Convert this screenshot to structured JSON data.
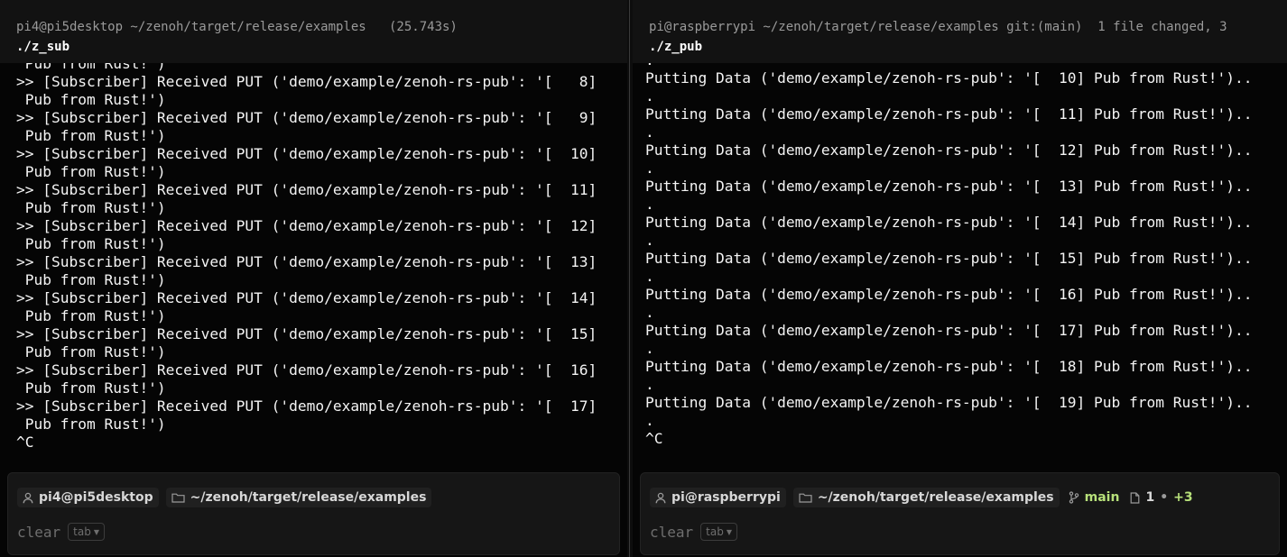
{
  "left": {
    "header": {
      "prompt": "pi4@pi5desktop ~/zenoh/target/release/examples   (25.743s)",
      "command": "./z_sub"
    },
    "output": [
      " Pub from Rust!')",
      ">> [Subscriber] Received PUT ('demo/example/zenoh-rs-pub': '[   8]",
      " Pub from Rust!')",
      ">> [Subscriber] Received PUT ('demo/example/zenoh-rs-pub': '[   9]",
      " Pub from Rust!')",
      ">> [Subscriber] Received PUT ('demo/example/zenoh-rs-pub': '[  10]",
      " Pub from Rust!')",
      ">> [Subscriber] Received PUT ('demo/example/zenoh-rs-pub': '[  11]",
      " Pub from Rust!')",
      ">> [Subscriber] Received PUT ('demo/example/zenoh-rs-pub': '[  12]",
      " Pub from Rust!')",
      ">> [Subscriber] Received PUT ('demo/example/zenoh-rs-pub': '[  13]",
      " Pub from Rust!')",
      ">> [Subscriber] Received PUT ('demo/example/zenoh-rs-pub': '[  14]",
      " Pub from Rust!')",
      ">> [Subscriber] Received PUT ('demo/example/zenoh-rs-pub': '[  15]",
      " Pub from Rust!')",
      ">> [Subscriber] Received PUT ('demo/example/zenoh-rs-pub': '[  16]",
      " Pub from Rust!')",
      ">> [Subscriber] Received PUT ('demo/example/zenoh-rs-pub': '[  17]",
      " Pub from Rust!')",
      "^C"
    ],
    "input": {
      "user": "pi4@pi5desktop",
      "path": "~/zenoh/target/release/examples",
      "command": "clear",
      "tab_hint": "tab"
    }
  },
  "right": {
    "header": {
      "prompt": "pi@raspberrypi ~/zenoh/target/release/examples git:(main)  1 file changed, 3",
      "command": "./z_pub"
    },
    "output": [
      ".",
      "Putting Data ('demo/example/zenoh-rs-pub': '[  10] Pub from Rust!')..",
      ".",
      "Putting Data ('demo/example/zenoh-rs-pub': '[  11] Pub from Rust!')..",
      ".",
      "Putting Data ('demo/example/zenoh-rs-pub': '[  12] Pub from Rust!')..",
      ".",
      "Putting Data ('demo/example/zenoh-rs-pub': '[  13] Pub from Rust!')..",
      ".",
      "Putting Data ('demo/example/zenoh-rs-pub': '[  14] Pub from Rust!')..",
      ".",
      "Putting Data ('demo/example/zenoh-rs-pub': '[  15] Pub from Rust!')..",
      ".",
      "Putting Data ('demo/example/zenoh-rs-pub': '[  16] Pub from Rust!')..",
      ".",
      "Putting Data ('demo/example/zenoh-rs-pub': '[  17] Pub from Rust!')..",
      ".",
      "Putting Data ('demo/example/zenoh-rs-pub': '[  18] Pub from Rust!')..",
      ".",
      "Putting Data ('demo/example/zenoh-rs-pub': '[  19] Pub from Rust!')..",
      ".",
      "^C"
    ],
    "input": {
      "user": "pi@raspberrypi",
      "path": "~/zenoh/target/release/examples",
      "branch": "main",
      "changed_files": "1",
      "separator": "•",
      "additions": "+3",
      "command": "clear",
      "tab_hint": "tab"
    }
  },
  "colors": {
    "background": "#050505",
    "header_bg": "#121212",
    "input_bg": "#161616",
    "text": "#f4f4f4",
    "muted": "#9a9a9a",
    "git_green": "#b7e07a"
  },
  "icons": {
    "user": "user-icon",
    "folder": "folder-icon",
    "branch": "git-branch-icon",
    "file": "file-icon",
    "caret": "chevron-down-icon"
  }
}
